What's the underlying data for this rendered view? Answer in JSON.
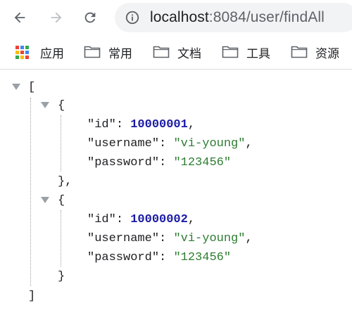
{
  "browser": {
    "url_host": "localhost",
    "url_rest": ":8084/user/findAll"
  },
  "bookmarks": [
    {
      "label": "应用",
      "icon": "apps-grid-icon"
    },
    {
      "label": "常用",
      "icon": "folder-icon"
    },
    {
      "label": "文档",
      "icon": "folder-icon"
    },
    {
      "label": "工具",
      "icon": "folder-icon"
    },
    {
      "label": "资源",
      "icon": "folder-icon"
    }
  ],
  "json": {
    "open_bracket": "[",
    "close_bracket": "]",
    "open_brace": "{",
    "close_brace": "}",
    "close_brace_comma": "},",
    "records": [
      {
        "id_key": "\"id\"",
        "id_value": "10000001",
        "username_key": "\"username\"",
        "username_value": "\"vi-young\"",
        "password_key": "\"password\"",
        "password_value": "\"123456\""
      },
      {
        "id_key": "\"id\"",
        "id_value": "10000002",
        "username_key": "\"username\"",
        "username_value": "\"vi-young\"",
        "password_key": "\"password\"",
        "password_value": "\"123456\""
      }
    ],
    "colon": ": ",
    "comma": ","
  },
  "colors": {
    "number": "#1a1aa6",
    "string": "#2e7d32",
    "guide": "#9aa0a6"
  }
}
